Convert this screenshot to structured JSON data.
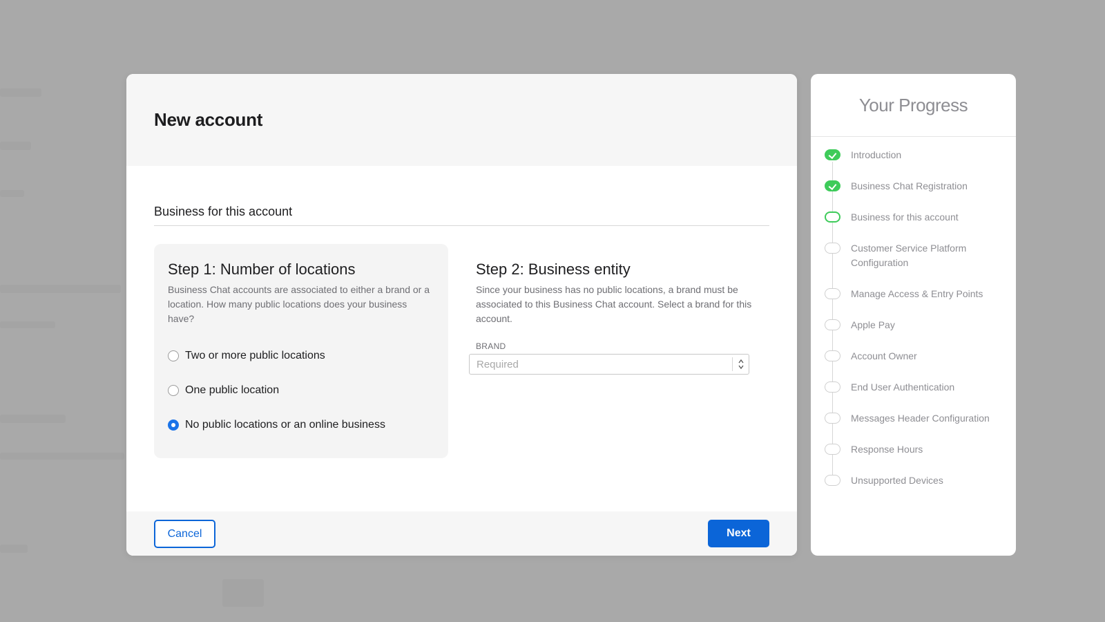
{
  "modal": {
    "title": "New account",
    "section_title": "Business for this account",
    "step1": {
      "title": "Step 1: Number of locations",
      "description": "Business Chat accounts are associated to either a brand or a location. How many public locations does your business have?",
      "options": [
        {
          "label": "Two or more public locations",
          "selected": false
        },
        {
          "label": "One public location",
          "selected": false
        },
        {
          "label": "No public locations or an online business",
          "selected": true
        }
      ]
    },
    "step2": {
      "title": "Step 2: Business entity",
      "description": "Since your business has no public locations, a brand must be associated to this Business Chat account. Select a brand for this account.",
      "field_label": "BRAND",
      "field_placeholder": "Required"
    },
    "footer": {
      "cancel_label": "Cancel",
      "next_label": "Next"
    }
  },
  "progress": {
    "title": "Your Progress",
    "items": [
      {
        "label": "Introduction",
        "status": "done"
      },
      {
        "label": "Business Chat Registration",
        "status": "done"
      },
      {
        "label": "Business for this account",
        "status": "current"
      },
      {
        "label": "Customer Service Platform Configuration",
        "status": "pending"
      },
      {
        "label": "Manage Access & Entry Points",
        "status": "pending"
      },
      {
        "label": "Apple Pay",
        "status": "pending"
      },
      {
        "label": "Account Owner",
        "status": "pending"
      },
      {
        "label": "End User Authentication",
        "status": "pending"
      },
      {
        "label": "Messages Header Configuration",
        "status": "pending"
      },
      {
        "label": "Response Hours",
        "status": "pending"
      },
      {
        "label": "Unsupported Devices",
        "status": "pending"
      }
    ]
  },
  "colors": {
    "accent": "#0b65d8",
    "success": "#3ecb5a",
    "overlay": "#a9a9a9"
  }
}
